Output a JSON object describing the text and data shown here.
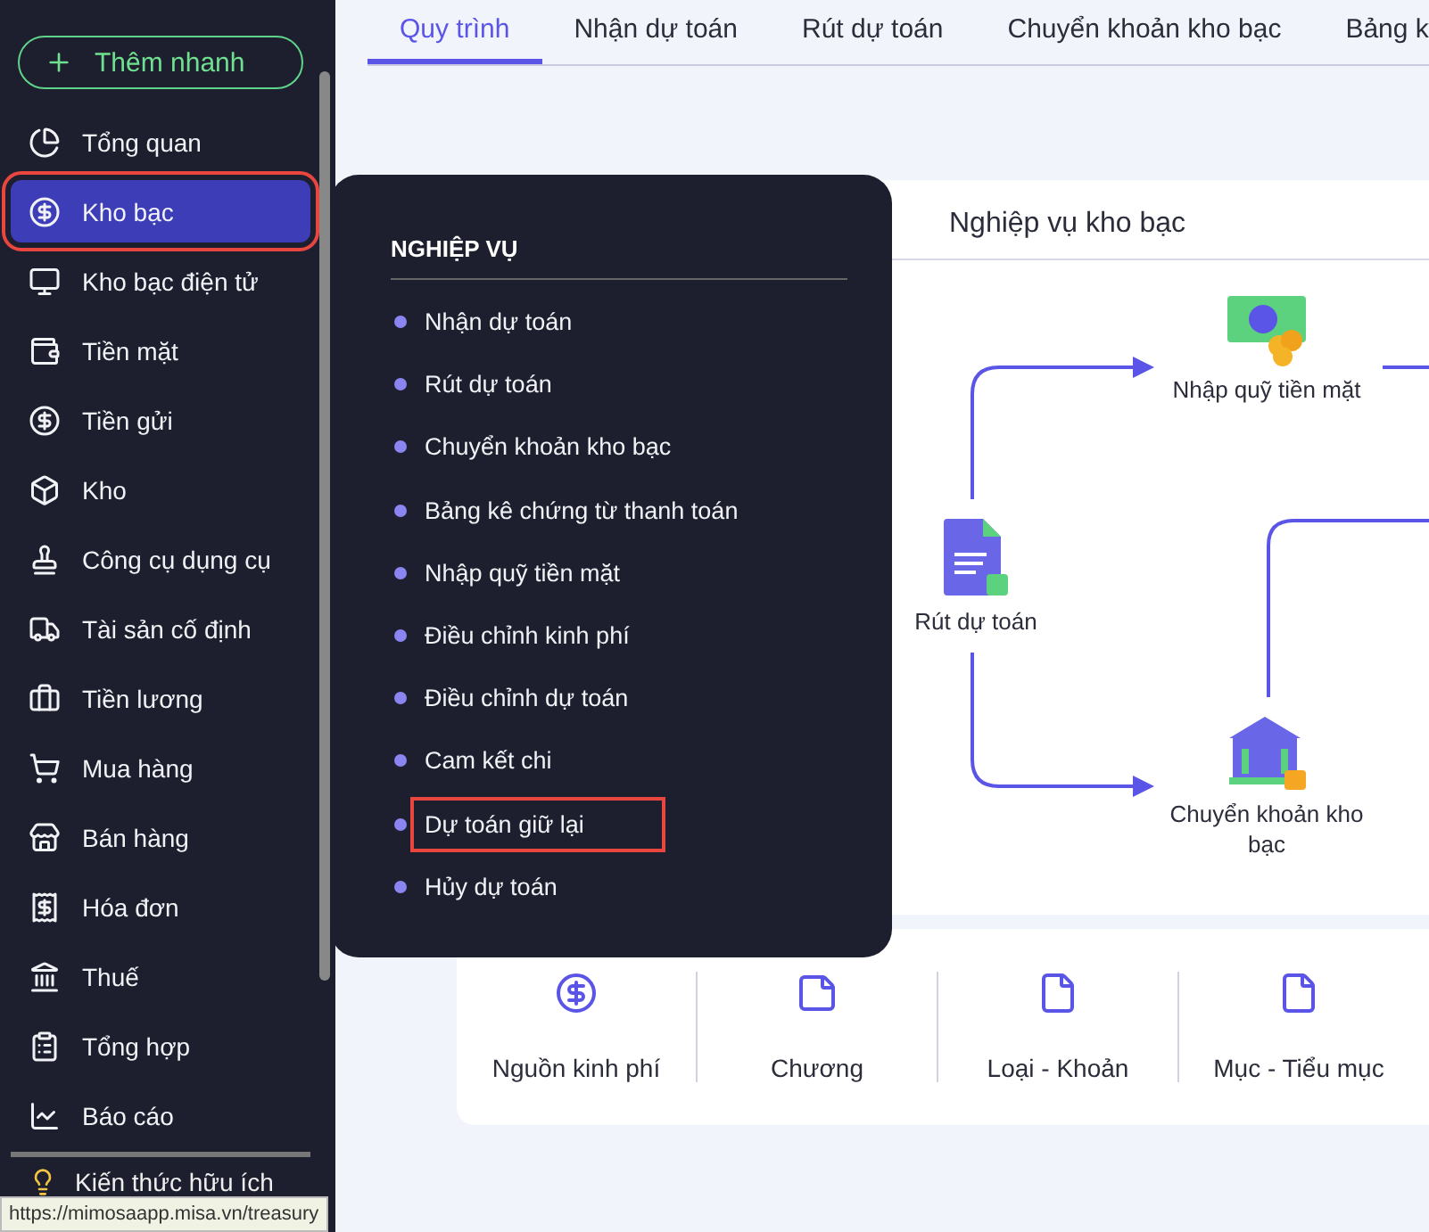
{
  "sidebar": {
    "quick_add": "Thêm nhanh",
    "items": [
      {
        "label": "Tổng quan",
        "kind": "overview",
        "selected": false,
        "highlighted": false
      },
      {
        "label": "Kho bạc",
        "kind": "treasury",
        "selected": true,
        "highlighted": true
      },
      {
        "label": "Kho bạc điện tử",
        "kind": "etreasury",
        "selected": false,
        "highlighted": false
      },
      {
        "label": "Tiền mặt",
        "kind": "cash",
        "selected": false,
        "highlighted": false
      },
      {
        "label": "Tiền gửi",
        "kind": "deposit",
        "selected": false,
        "highlighted": false
      },
      {
        "label": "Kho",
        "kind": "stock",
        "selected": false,
        "highlighted": false
      },
      {
        "label": "Công cụ dụng cụ",
        "kind": "tools",
        "selected": false,
        "highlighted": false
      },
      {
        "label": "Tài sản cố định",
        "kind": "asset",
        "selected": false,
        "highlighted": false
      },
      {
        "label": "Tiền lương",
        "kind": "salary",
        "selected": false,
        "highlighted": false
      },
      {
        "label": "Mua hàng",
        "kind": "purchase",
        "selected": false,
        "highlighted": false
      },
      {
        "label": "Bán hàng",
        "kind": "sales",
        "selected": false,
        "highlighted": false
      },
      {
        "label": "Hóa đơn",
        "kind": "invoice",
        "selected": false,
        "highlighted": false
      },
      {
        "label": "Thuế",
        "kind": "tax",
        "selected": false,
        "highlighted": false
      },
      {
        "label": "Tổng hợp",
        "kind": "summary",
        "selected": false,
        "highlighted": false
      },
      {
        "label": "Báo cáo",
        "kind": "report",
        "selected": false,
        "highlighted": false
      }
    ],
    "footer_item": "Kiến thức hữu ích"
  },
  "tabs": [
    {
      "label": "Quy trình",
      "selected": true
    },
    {
      "label": "Nhận dự toán",
      "selected": false
    },
    {
      "label": "Rút dự toán",
      "selected": false
    },
    {
      "label": "Chuyển khoản kho bạc",
      "selected": false
    },
    {
      "label": "Bảng k",
      "selected": false
    }
  ],
  "diagram": {
    "title": "Nghiệp vụ kho bạc",
    "nodes": [
      {
        "label": "Nhập quỹ tiền mặt",
        "kind": "cash"
      },
      {
        "label": "Rút dự toán",
        "kind": "document"
      },
      {
        "label": "Chuyển khoản kho bạc",
        "kind": "bank"
      }
    ]
  },
  "categories": [
    {
      "label": "Nguồn kinh phí",
      "kind": "dollar"
    },
    {
      "label": "Chương",
      "kind": "note"
    },
    {
      "label": "Loại - Khoản",
      "kind": "folder"
    },
    {
      "label": "Mục - Tiểu mục",
      "kind": "folder"
    }
  ],
  "popup": {
    "heading": "NGHIỆP VỤ",
    "items": [
      {
        "label": "Nhận dự toán",
        "highlighted": false
      },
      {
        "label": "Rút dự toán",
        "highlighted": false
      },
      {
        "label": "Chuyển khoản kho bạc",
        "highlighted": false
      },
      {
        "label": "Bảng kê chứng từ thanh toán",
        "highlighted": false
      },
      {
        "label": "Nhập quỹ tiền mặt",
        "highlighted": false
      },
      {
        "label": "Điều chỉnh kinh phí",
        "highlighted": false
      },
      {
        "label": "Điều chỉnh dự toán",
        "highlighted": false
      },
      {
        "label": "Cam kết chi",
        "highlighted": false
      },
      {
        "label": "Dự toán giữ lại",
        "highlighted": true
      },
      {
        "label": "Hủy dự toán",
        "highlighted": false
      }
    ]
  },
  "status_url": "https://mimosaapp.misa.vn/treasury"
}
